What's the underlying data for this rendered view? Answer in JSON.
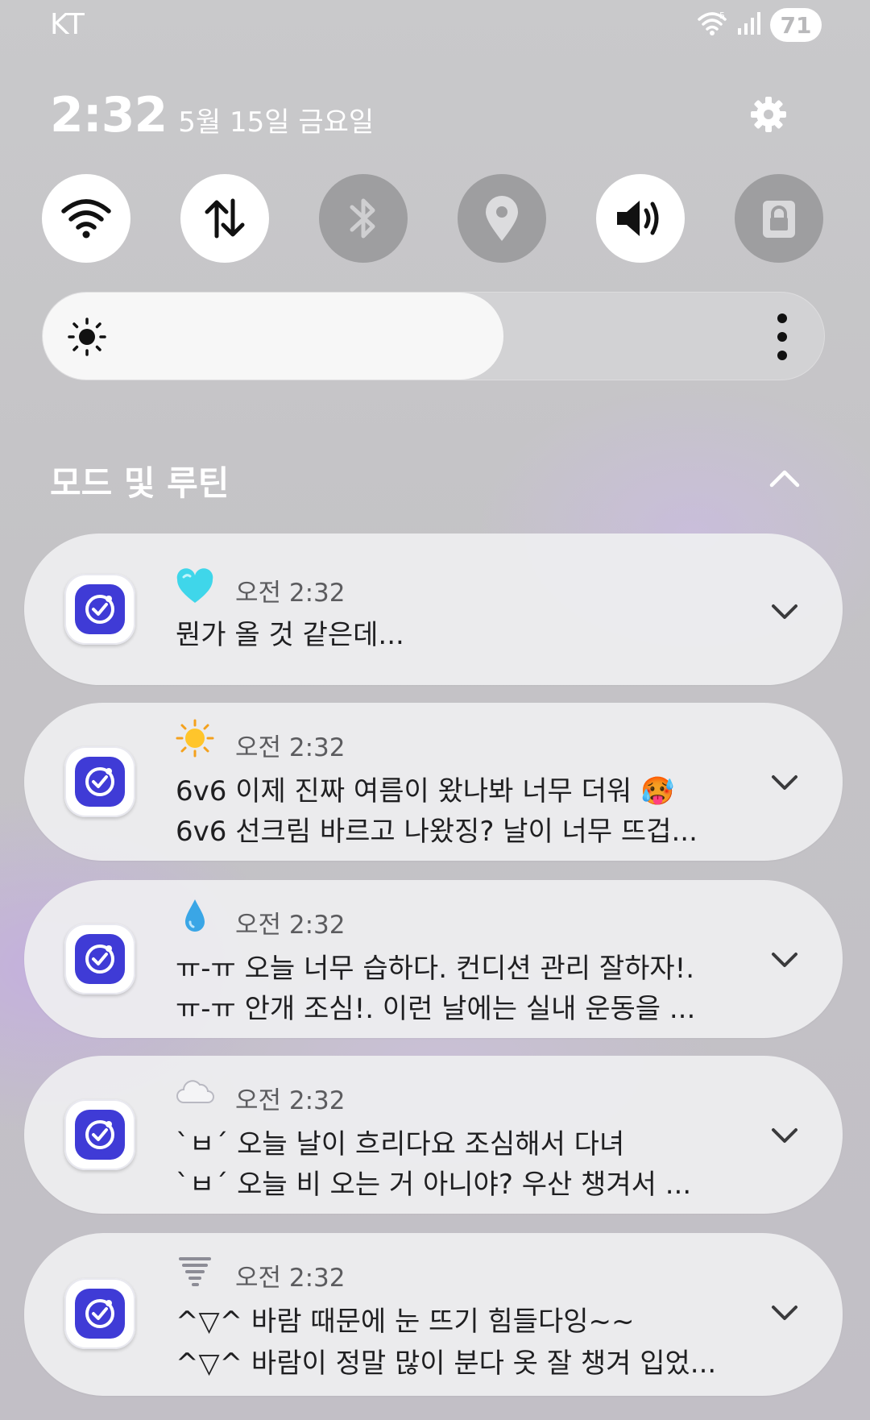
{
  "status_bar": {
    "carrier": "KT",
    "battery": "71",
    "wifi_label": "5",
    "icons": [
      "wifi-icon",
      "signal-icon",
      "battery-icon"
    ]
  },
  "header": {
    "time": "2:32",
    "date": "5월 15일 금요일"
  },
  "quick_settings": [
    {
      "name": "wifi",
      "icon": "wifi-icon",
      "state": "on"
    },
    {
      "name": "mobile-data",
      "icon": "data-arrows-icon",
      "state": "on"
    },
    {
      "name": "bluetooth",
      "icon": "bluetooth-icon",
      "state": "off"
    },
    {
      "name": "location",
      "icon": "location-pin-icon",
      "state": "off"
    },
    {
      "name": "sound",
      "icon": "speaker-icon",
      "state": "on"
    },
    {
      "name": "lock",
      "icon": "lock-icon",
      "state": "off"
    }
  ],
  "brightness": {
    "level": 0.59,
    "icon": "sun-icon"
  },
  "section": {
    "title": "모드 및 루틴"
  },
  "notifications": [
    {
      "emoji": "light-blue-heart",
      "time": "오전 2:32",
      "lines": [
        "뭔가 올 것 같은데..."
      ]
    },
    {
      "emoji": "sun",
      "time": "오전 2:32",
      "lines": [
        "6v6 이제 진짜 여름이 왔나봐 너무 더워 🥵",
        "6v6 선크림 바르고 나왔징? 날이 너무 뜨겁..."
      ]
    },
    {
      "emoji": "droplet",
      "time": "오전 2:32",
      "lines": [
        "ㅠ-ㅠ 오늘 너무 습하다. 컨디션 관리 잘하자!.",
        "ㅠ-ㅠ 안개 조심!. 이런 날에는 실내 운동을 ..."
      ]
    },
    {
      "emoji": "cloud",
      "time": "오전 2:32",
      "lines": [
        "`ㅂ´ 오늘 날이 흐리다요 조심해서 다녀",
        "`ㅂ´ 오늘 비 오는 거 아니야? 우산 챙겨서 ..."
      ]
    },
    {
      "emoji": "tornado",
      "time": "오전 2:32",
      "lines": [
        "^▽^ 바람 때문에 눈 뜨기 힘들다잉~~",
        "^▽^ 바람이 정말 많이 분다 옷 잘 챙겨 입었..."
      ]
    }
  ],
  "colors": {
    "accent": "#3f3bd6",
    "tile_on": "#ffffff",
    "tile_off": "#9e9ea0"
  }
}
